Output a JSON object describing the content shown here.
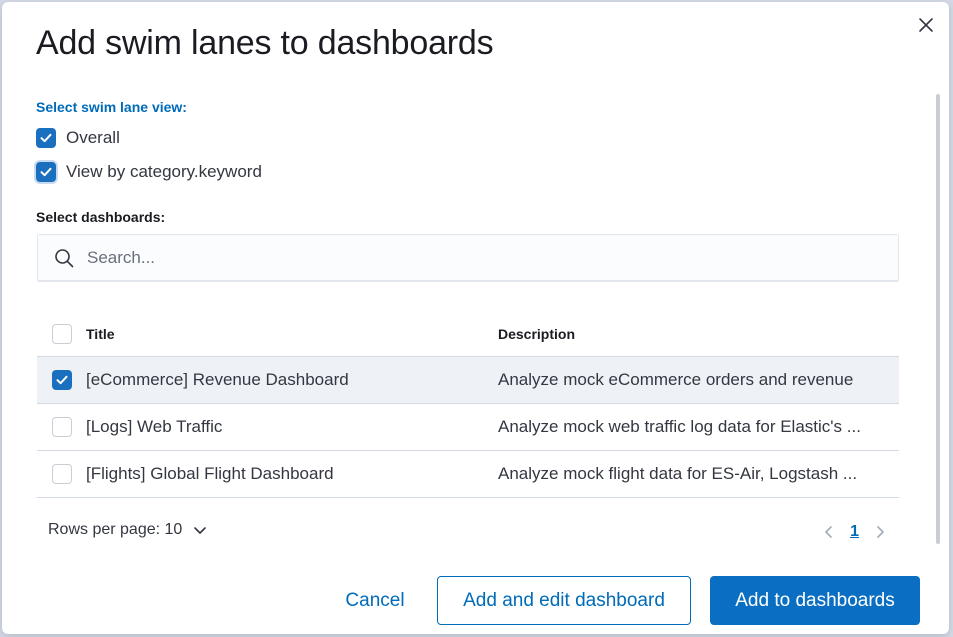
{
  "modal": {
    "title": "Add swim lanes to dashboards"
  },
  "swimlane_view": {
    "label": "Select swim lane view:",
    "options": [
      {
        "label": "Overall",
        "checked": true
      },
      {
        "label": "View by category.keyword",
        "checked": true
      }
    ]
  },
  "dashboards": {
    "label": "Select dashboards:",
    "search_placeholder": "Search...",
    "columns": {
      "title": "Title",
      "description": "Description"
    },
    "rows": [
      {
        "title": "[eCommerce] Revenue Dashboard",
        "description": "Analyze mock eCommerce orders and revenue",
        "checked": true
      },
      {
        "title": "[Logs] Web Traffic",
        "description": "Analyze mock web traffic log data for Elastic's ...",
        "checked": false
      },
      {
        "title": "[Flights] Global Flight Dashboard",
        "description": "Analyze mock flight data for ES-Air, Logstash ...",
        "checked": false
      }
    ]
  },
  "pagination": {
    "rows_per_page": "Rows per page: 10",
    "current_page": "1"
  },
  "footer": {
    "cancel_label": "Cancel",
    "add_edit_label": "Add and edit dashboard",
    "add_label": "Add to dashboards"
  },
  "colors": {
    "primary": "#006bb8",
    "primary_fill": "#0a6ec2",
    "selected_row": "#eef2f7",
    "border": "#d3dae6"
  },
  "icons": {
    "close": "close-icon",
    "search": "search-icon",
    "check": "check-icon",
    "chevron_down": "chevron-down-icon",
    "arrow_left": "arrow-left-icon",
    "arrow_right": "arrow-right-icon"
  }
}
